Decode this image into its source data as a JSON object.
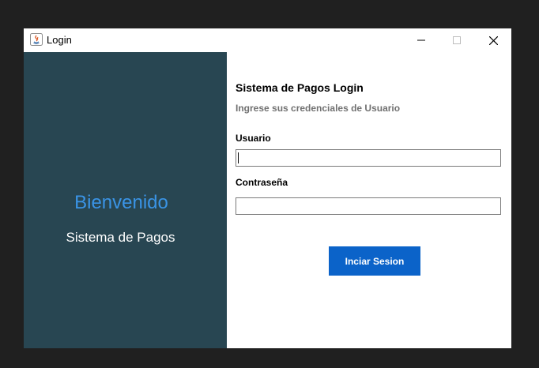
{
  "window": {
    "title": "Login",
    "controls": {
      "minimize": "minimize-icon",
      "maximize": "maximize-icon",
      "close": "close-icon"
    }
  },
  "welcome_panel": {
    "heading": "Bienvenido",
    "subheading": "Sistema de Pagos",
    "background_color": "#284652",
    "heading_color": "#3a94e6"
  },
  "login_form": {
    "title": "Sistema de Pagos Login",
    "hint": "Ingrese sus credenciales de Usuario",
    "username": {
      "label": "Usuario",
      "value": ""
    },
    "password": {
      "label": "Contraseña",
      "value": ""
    },
    "submit_label": "Inciar Sesion",
    "submit_color": "#0b63c9"
  }
}
